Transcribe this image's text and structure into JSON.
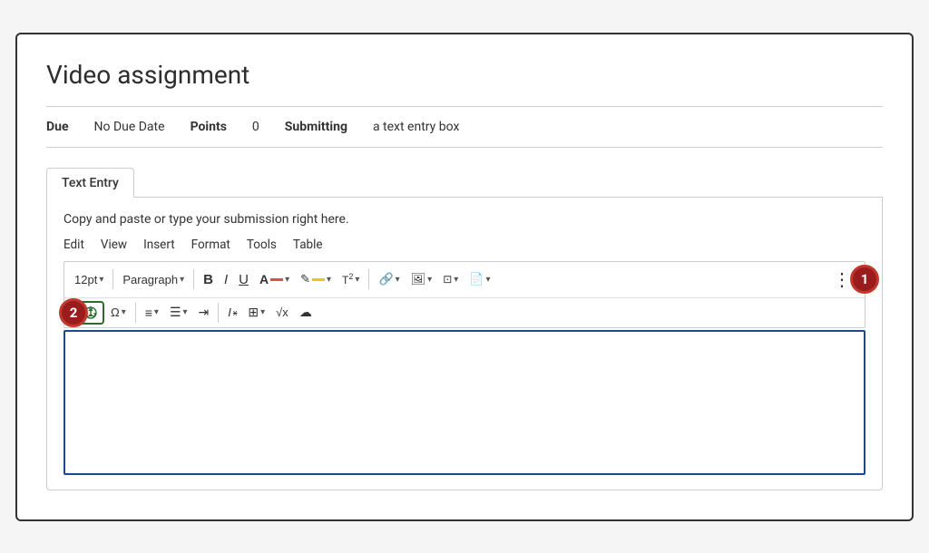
{
  "page": {
    "title": "Video assignment",
    "meta": {
      "due_label": "Due",
      "due_value": "No Due Date",
      "points_label": "Points",
      "points_value": "0",
      "submitting_label": "Submitting",
      "submitting_value": "a text entry box"
    },
    "tab": {
      "label": "Text Entry"
    },
    "editor": {
      "hint": "Copy and paste or type your submission right here.",
      "menu": [
        "Edit",
        "View",
        "Insert",
        "Format",
        "Tools",
        "Table"
      ],
      "toolbar_row1": {
        "font_size": "12pt",
        "paragraph": "Paragraph",
        "bold": "B",
        "italic": "I",
        "underline": "U"
      }
    },
    "badges": {
      "badge1": "1",
      "badge2": "2"
    }
  }
}
